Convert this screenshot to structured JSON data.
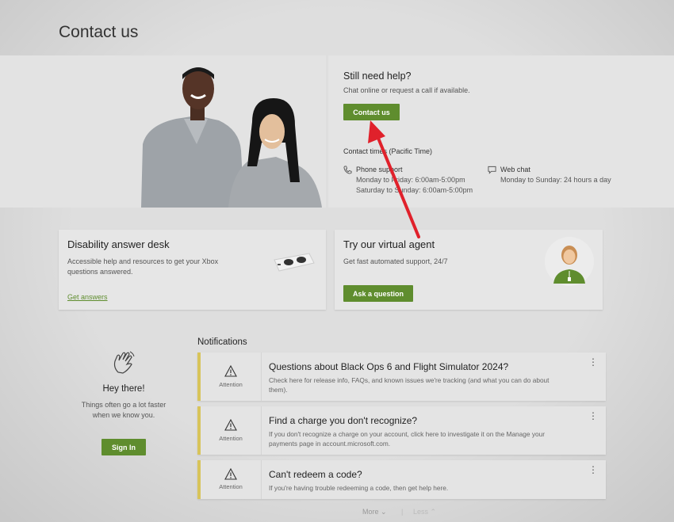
{
  "page": {
    "title": "Contact us"
  },
  "help": {
    "title": "Still need help?",
    "subtitle": "Chat online or request a call if available.",
    "contact_button": "Contact us",
    "contact_times": "Contact times (Pacific Time)",
    "phone": {
      "label": "Phone support",
      "line1": "Monday to Friday: 6:00am-5:00pm",
      "line2": "Saturday to Sunday: 6:00am-5:00pm"
    },
    "chat": {
      "label": "Web chat",
      "line1": "Monday to Sunday: 24 hours a day"
    }
  },
  "disability": {
    "title": "Disability answer desk",
    "desc": "Accessible help and resources to get your Xbox questions answered.",
    "link": "Get answers"
  },
  "agent": {
    "title": "Try our virtual agent",
    "desc": "Get fast automated support, 24/7",
    "button": "Ask a question"
  },
  "greeting": {
    "title": "Hey there!",
    "desc": "Things often go a lot faster when we know you.",
    "button": "Sign In"
  },
  "notifications": {
    "heading": "Notifications",
    "items": [
      {
        "badge": "Attention",
        "title": "Questions about Black Ops 6 and Flight Simulator 2024?",
        "desc": "Check here for release info, FAQs, and known issues we're tracking (and what you can do about them)."
      },
      {
        "badge": "Attention",
        "title": "Find a charge you don't recognize?",
        "desc": "If you don't recognize a charge on your account, click here to investigate it on the Manage your payments page in account.microsoft.com."
      },
      {
        "badge": "Attention",
        "title": "Can't redeem a code?",
        "desc": "If you're having trouble redeeming a code, then get help here."
      }
    ],
    "more": "More",
    "less": "Less"
  },
  "colors": {
    "accent": "#5f8d2e",
    "attention": "#d8c45a",
    "arrow": "#e0212b"
  }
}
